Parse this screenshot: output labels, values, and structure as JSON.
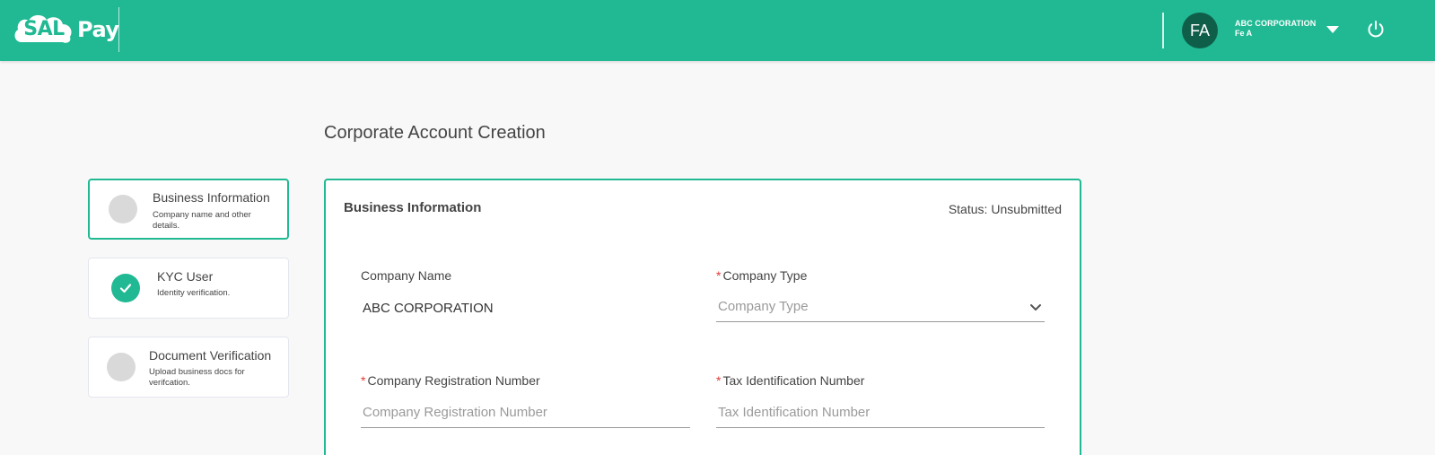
{
  "header": {
    "logo_mark": "SAL",
    "logo_text": "Pay",
    "avatar_initials": "FA",
    "company": "ABC CORPORATION",
    "user": "Fe A",
    "brand_color": "#20b993"
  },
  "page": {
    "title": "Corporate Account Creation"
  },
  "steps": [
    {
      "title": "Business Information",
      "desc": "Company name and other details.",
      "state": "active"
    },
    {
      "title": "KYC User",
      "desc": "Identity verification.",
      "state": "done"
    },
    {
      "title": "Document Verification",
      "desc": "Upload business docs for verifcation.",
      "state": "pending"
    }
  ],
  "card": {
    "title": "Business Information",
    "status_label": "Status:",
    "status_value": "Unsubmitted"
  },
  "form": {
    "company_name": {
      "label": "Company Name",
      "value": "ABC CORPORATION"
    },
    "company_type": {
      "required_mark": "*",
      "label": "Company Type",
      "placeholder": "Company Type"
    },
    "registration_number": {
      "required_mark": "*",
      "label": "Company Registration Number",
      "placeholder": "Company Registration Number"
    },
    "tax_id": {
      "required_mark": "*",
      "label": "Tax Identification Number",
      "placeholder": "Tax Identification Number"
    }
  }
}
